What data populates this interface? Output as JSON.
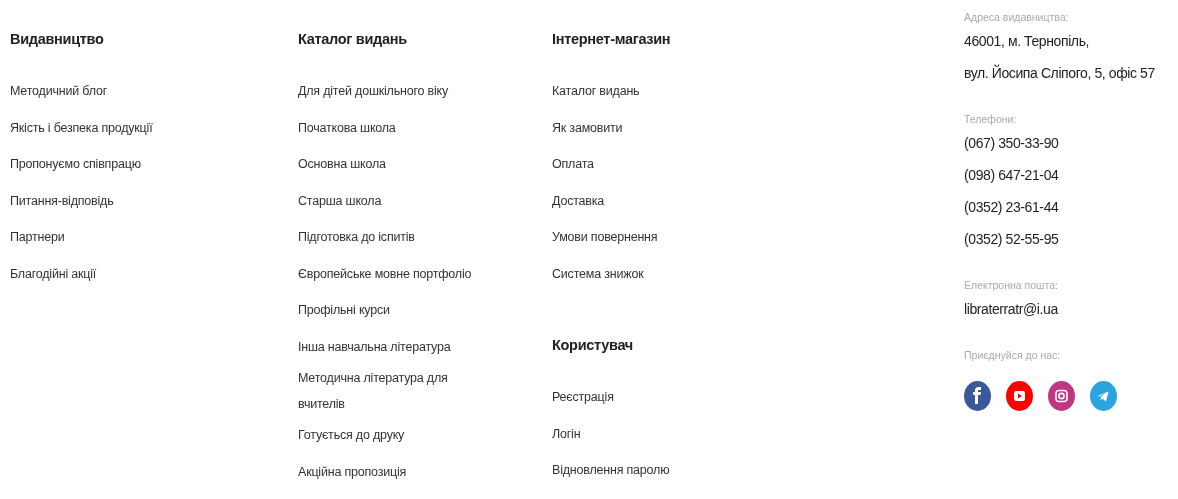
{
  "columns": [
    {
      "sections": [
        {
          "heading": "Видавництво",
          "links": [
            "Методичний блог",
            "Якість і безпека продукції",
            "Пропонуємо співпрацю",
            "Питання-відповідь",
            "Партнери",
            "Благодійні акції"
          ]
        }
      ]
    },
    {
      "sections": [
        {
          "heading": "Каталог видань",
          "links": [
            "Для дітей дошкільного віку",
            "Початкова школа",
            "Основна школа",
            "Старша школа",
            "Підготовка до іспитів",
            "Європейське мовне портфоліо",
            "Профільні курси",
            "Інша навчальна література",
            "Методична література для вчителів",
            "Готується до друку",
            "Акційна пропозиція"
          ]
        }
      ]
    },
    {
      "sections": [
        {
          "heading": "Інтернет-магазин",
          "links": [
            "Каталог видань",
            "Як замовити",
            "Оплата",
            "Доставка",
            "Умови повернення",
            "Система знижок"
          ]
        },
        {
          "heading": "Користувач",
          "links": [
            "Реєстрація",
            "Логін",
            "Відновлення паролю"
          ]
        }
      ]
    }
  ],
  "contacts": {
    "groups": [
      {
        "label": "Адреса видавництва:",
        "lines": [
          "46001, м. Тернопіль,",
          "вул. Йосипа Сліпого, 5, офіс 57"
        ]
      },
      {
        "label": "Телефони:",
        "lines": [
          "(067) 350-33-90",
          "(098) 647-21-04",
          "(0352) 23-61-44",
          "(0352) 52-55-95"
        ]
      },
      {
        "label": "Електронна пошта:",
        "lines": [
          "libraterratr@i.ua"
        ]
      }
    ],
    "social_label": "Приєднуйся до нас:",
    "social": [
      {
        "kind": "facebook",
        "color": "#3b5998"
      },
      {
        "kind": "youtube",
        "color": "#ff0000"
      },
      {
        "kind": "instagram",
        "color": "#c13584"
      },
      {
        "kind": "telegram",
        "color": "#2aa3e0"
      }
    ]
  }
}
